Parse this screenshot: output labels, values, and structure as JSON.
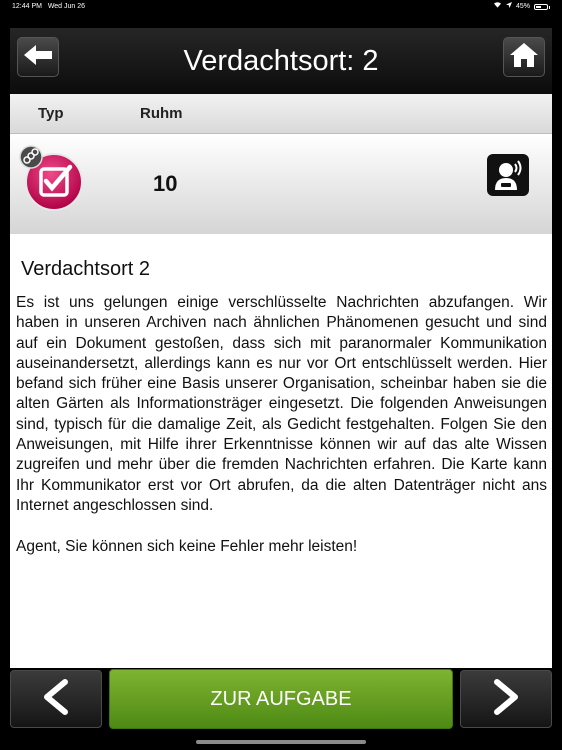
{
  "status_bar": {
    "time": "12:44 PM",
    "date": "Wed Jun 26",
    "battery": "45%"
  },
  "nav": {
    "title": "Verdachtsort: 2",
    "back_icon": "arrow-left-icon",
    "home_icon": "home-icon"
  },
  "table": {
    "headers": [
      "Typ",
      "Ruhm"
    ],
    "row": {
      "type_icon": "checkbox-icon",
      "ruhm": "10",
      "agent_icon": "agent-communicator-icon"
    }
  },
  "place": {
    "title": "Verdachtsort 2",
    "description": "Es ist uns gelungen einige verschlüsselte Nachrichten abzufangen. Wir haben in unseren Archiven nach ähnlichen Phänomenen gesucht und sind auf ein Dokument gestoßen, dass sich mit paranormaler Kommunikation auseinandersetzt, allerdings kann es nur vor Ort entschlüsselt werden. Hier befand sich früher eine Basis unserer Organisation, scheinbar haben sie die alten Gärten als Informationsträger eingesetzt. Die folgenden Anweisungen sind, typisch für die damalige Zeit, als Gedicht festgehalten. Folgen Sie den Anweisungen, mit Hilfe ihrer Erkenntnisse können wir auf das alte Wissen zugreifen und mehr über die fremden Nachrichten erfahren. Die Karte kann Ihr Kommunikator erst vor Ort abrufen, da die alten Datenträger nicht ans Internet angeschlossen sind.",
    "warning": "Agent, Sie können sich keine Fehler mehr leisten!"
  },
  "bottom": {
    "task_label": "ZUR AUFGABE",
    "prev_icon": "chevron-left-icon",
    "next_icon": "chevron-right-icon"
  },
  "colors": {
    "accent_green": "#6aa524",
    "type_icon_pink": "#d4135a"
  }
}
